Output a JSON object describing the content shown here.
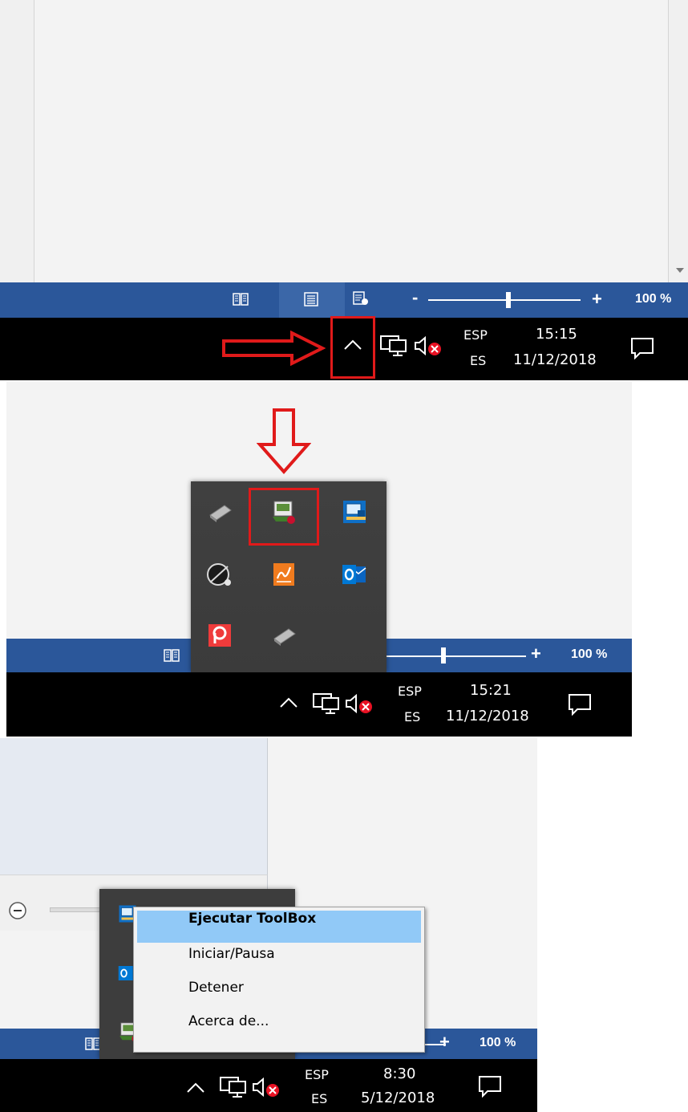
{
  "accent": {
    "word_blue": "#2b579a",
    "taskbar": "#000000",
    "highlight_red": "#e01a1a",
    "menu_hover": "#91c9f7"
  },
  "panel1": {
    "statusbar": {
      "zoom_percent": "100 %",
      "zoom_minus": "-",
      "zoom_plus": "+",
      "icons": [
        "read-mode-icon",
        "print-layout-icon",
        "web-layout-icon"
      ]
    },
    "taskbar": {
      "lang_top": "ESP",
      "lang_bottom": "ES",
      "time": "15:15",
      "date": "11/12/2018"
    }
  },
  "panel2": {
    "statusbar": {
      "zoom_percent": "100 %",
      "zoom_plus": "+"
    },
    "taskbar": {
      "lang_top": "ESP",
      "lang_bottom": "ES",
      "time": "15:21",
      "date": "11/12/2018"
    },
    "tray_icons": [
      "usb-drive-icon",
      "toolbox-app-icon",
      "intel-graphics-icon",
      "satellite-dish-icon",
      "signature-app-icon",
      "outlook-icon",
      "pdf-reader-icon",
      "usb-drive-icon"
    ]
  },
  "panel3": {
    "statusbar": {
      "zoom_percent": "100 %",
      "zoom_plus": "+"
    },
    "taskbar": {
      "lang_top": "ESP",
      "lang_bottom": "ES",
      "time": "8:30",
      "date": "5/12/2018"
    },
    "context_menu": {
      "items": [
        {
          "label": "Ejecutar ToolBox"
        },
        {
          "label": "Iniciar/Pausa"
        },
        {
          "label": "Detener"
        },
        {
          "label": "Acerca de..."
        }
      ]
    }
  }
}
